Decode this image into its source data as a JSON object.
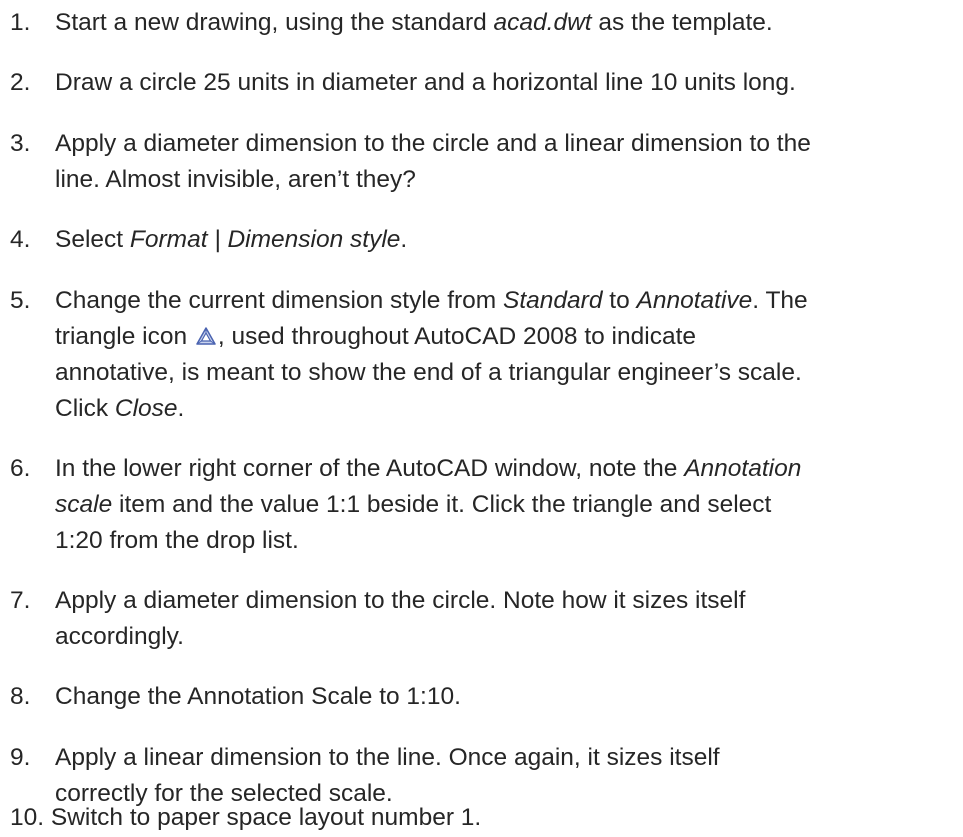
{
  "steps": [
    {
      "number": "1.",
      "pre": "Start a new drawing, using the standard ",
      "em": "acad.dwt",
      "post": " as the template."
    },
    {
      "number": "2.",
      "text": "Draw a circle 25 units in diameter and a horizontal line 10 units long."
    },
    {
      "number": "3.",
      "line1": "Apply a diameter dimension to the circle and a linear dimension to the",
      "line2": "line. Almost invisible, aren’t they?"
    },
    {
      "number": "4.",
      "pre": "Select ",
      "em": "Format | Dimension style",
      "post": "."
    },
    {
      "number": "5.",
      "l1_pre": "Change the current dimension style from ",
      "l1_em1": "Standard",
      "l1_mid": " to ",
      "l1_em2": "Annotative",
      "l1_post": ". The",
      "l2_pre": "triangle icon ",
      "l2_icon": "annotative-triangle-icon",
      "l2_post": ", used throughout AutoCAD 2008 to indicate",
      "l3": "annotative, is meant to show the end of a triangular engineer’s scale.",
      "l4_pre": "Click ",
      "l4_em": "Close",
      "l4_post": "."
    },
    {
      "number": "6.",
      "l1_pre": "In the lower right corner of the AutoCAD window, note the ",
      "l1_em": "Annotation",
      "l2_em": "scale",
      "l2_post": " item and the value 1:1 beside it. Click the triangle and select",
      "l3": "1:20 from the drop list."
    },
    {
      "number": "7.",
      "line1": "Apply a diameter dimension to the circle. Note how it sizes itself",
      "line2": "accordingly."
    },
    {
      "number": "8.",
      "text": "Change the Annotation Scale to 1:10."
    },
    {
      "number": "9.",
      "line1": "Apply a linear dimension to the line. Once again, it sizes itself",
      "line2": "correctly for the selected scale."
    },
    {
      "number": "10.",
      "text": "Switch to paper space layout number 1."
    }
  ],
  "colors": {
    "text": "#262626",
    "icon_light": "#c9d3ee",
    "icon_dark": "#4a63b0"
  }
}
